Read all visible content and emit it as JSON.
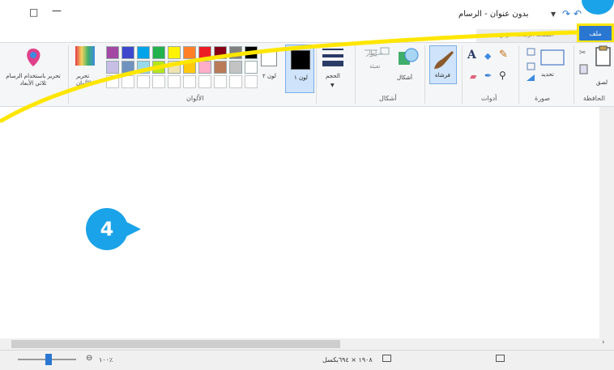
{
  "window": {
    "title": "بدون عنوان - الرسام",
    "maximize_glyph": "□",
    "minimize_glyph": "—"
  },
  "tabs": {
    "file": "ملف",
    "other": "الصفحة الرئيسية   عرض"
  },
  "ribbon": {
    "groups": {
      "clipboard": "الحافظة",
      "image": "صورة",
      "tools": "أدوات",
      "shapes": "أشكال",
      "colors": "الألوان"
    },
    "buttons": {
      "paste": "لصق",
      "select": "تحديد",
      "brushes": "فرشاة",
      "shapes": "أشكال",
      "outline": "إطار",
      "fill": "تعبئة",
      "size": "الحجم",
      "color1": "لون ١",
      "color2": "لون ٢",
      "edit_colors": "تحرير الألوان",
      "paint3d": "تحرير باستخدام الرسام ثلاثي الأبعاد"
    },
    "palette_row1": [
      "#000000",
      "#7f7f7f",
      "#880015",
      "#ed1c24",
      "#ff7f27",
      "#fff200",
      "#22b14c",
      "#00a2e8",
      "#3f48cc",
      "#a349a4"
    ],
    "palette_row2": [
      "#ffffff",
      "#c3c3c3",
      "#b97a57",
      "#ffaec9",
      "#ffc90e",
      "#efe4b0",
      "#b5e61d",
      "#99d9ea",
      "#7092be",
      "#c8bfe7"
    ]
  },
  "status": {
    "dimensions": "١٩٠٨ × ٦٩٤بكسل",
    "zoom": "١٠٠٪"
  },
  "annotation": {
    "step": "4"
  },
  "colors": {
    "accent": "#2a77d2",
    "highlight": "#ffe600",
    "badge": "#1aa3e8"
  }
}
